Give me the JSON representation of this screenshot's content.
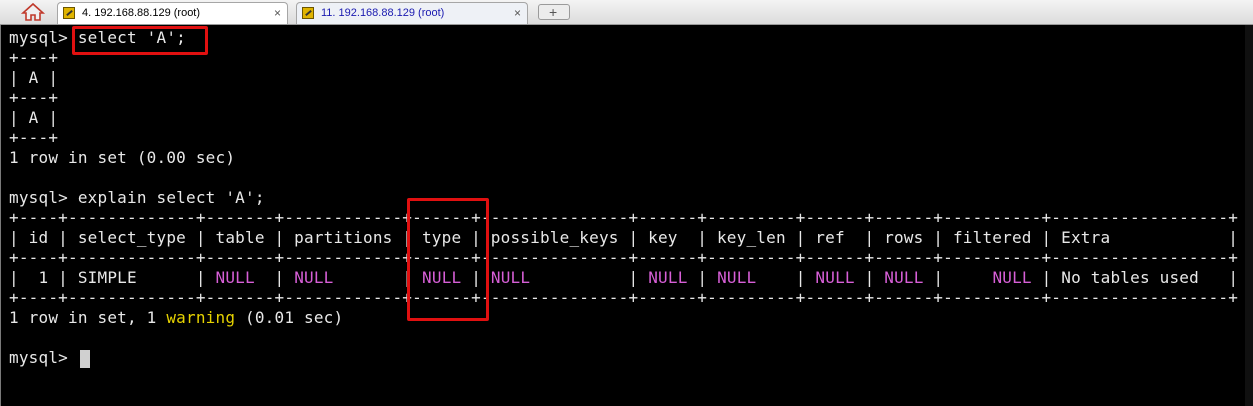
{
  "tabs": [
    {
      "label": "4. 192.168.88.129 (root)",
      "close": "×",
      "active": true
    },
    {
      "label": "11. 192.168.88.129 (root)",
      "close": "×",
      "active": false
    }
  ],
  "new_tab_symbol": "+",
  "terminal": {
    "lines": [
      "mysql> select 'A';",
      "+---+",
      "| A |",
      "+---+",
      "| A |",
      "+---+",
      "1 row in set (0.00 sec)",
      "",
      "mysql> explain select 'A';",
      "+----+-------------+-------+------------+------+---------------+------+---------+------+------+----------+------------------+",
      "| id | select_type | table | partitions | type | possible_keys | key  | key_len | ref  | rows | filtered | Extra            |",
      "+----+-------------+-------+------------+------+---------------+------+---------+------+------+----------+------------------+",
      "|  1 | SIMPLE      | NULL  | NULL       | NULL | NULL          | NULL | NULL    | NULL | NULL |     NULL | No tables used   |",
      "+----+-------------+-------+------------+------+---------------+------+---------+------+------+----------+------------------+",
      "1 row in set, 1 warning (0.01 sec)",
      "",
      "mysql> "
    ],
    "null_token": "NULL",
    "warning_token": "warning",
    "colors": {
      "null": "#d75fd7",
      "warning": "#e6d200",
      "text": "#e8e8e8",
      "highlight": "#e01010"
    }
  }
}
